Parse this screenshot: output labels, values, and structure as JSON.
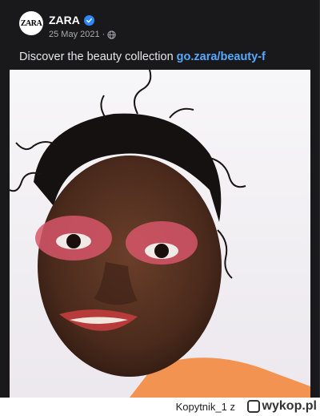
{
  "post": {
    "author": "ZARA",
    "avatar_text": "ZARA",
    "date": "25 May 2021",
    "separator": "·",
    "caption_text": "Discover the beauty collection",
    "caption_link": "go.zara/beauty-f",
    "photo_alt": "model portrait"
  },
  "footer": {
    "credit": "Kopytnik_1 z",
    "site": "wykop.pl"
  },
  "colors": {
    "background": "#19191b",
    "link": "#56a9ff",
    "verified": "#2d88ff"
  },
  "icons": [
    "verified-badge-icon",
    "globe-icon",
    "wykop-logo-icon"
  ]
}
